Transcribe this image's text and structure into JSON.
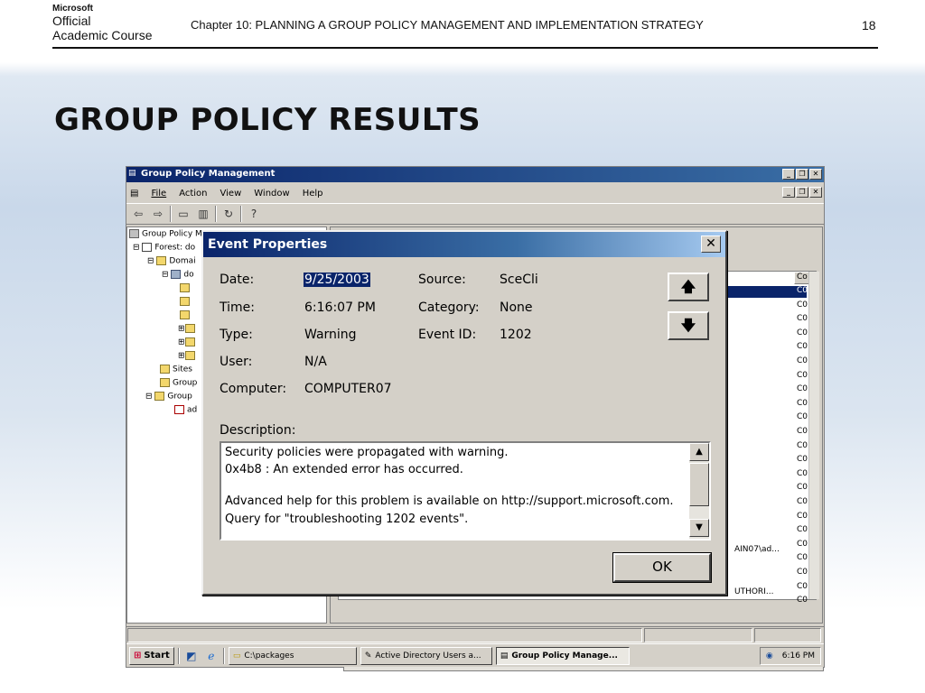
{
  "slide": {
    "logo": {
      "line0": "Microsoft",
      "line1": "Official",
      "line2": "Academic Course"
    },
    "chapter": "Chapter 10: PLANNING A GROUP POLICY MANAGEMENT AND IMPLEMENTATION STRATEGY",
    "page_number": "18",
    "title": "GROUP POLICY RESULTS"
  },
  "app": {
    "title": "Group Policy Management",
    "menu": [
      "File",
      "Action",
      "View",
      "Window",
      "Help"
    ],
    "tree": [
      "Group Policy M",
      "Forest: do",
      "Domai",
      "do",
      "Sites",
      "Group",
      "Group",
      "ad"
    ],
    "list_column_header": "Co",
    "list_code": "C0",
    "list_fragments": {
      "row1": "AIN07\\ad...",
      "row2": "UTHORI..."
    }
  },
  "dialog": {
    "title": "Event Properties",
    "fields": {
      "date_label": "Date:",
      "date_value": "9/25/2003",
      "time_label": "Time:",
      "time_value": "6:16:07 PM",
      "type_label": "Type:",
      "type_value": "Warning",
      "user_label": "User:",
      "user_value": "N/A",
      "computer_label": "Computer:",
      "computer_value": "COMPUTER07",
      "source_label": "Source:",
      "source_value": "SceCli",
      "category_label": "Category:",
      "category_value": "None",
      "eventid_label": "Event ID:",
      "eventid_value": "1202"
    },
    "description_label": "Description:",
    "description_lines": [
      "Security policies were propagated with warning.",
      "0x4b8 : An extended error has occurred.",
      "",
      "Advanced help for this problem is available on http://support.microsoft.com.",
      "Query for \"troubleshooting 1202 events\"."
    ],
    "up_icon": "arrow-up",
    "down_icon": "arrow-down",
    "ok_label": "OK"
  },
  "taskbar": {
    "start_label": "Start",
    "tasks": [
      "C:\\packages",
      "Active Directory Users a...",
      "Group Policy Manage..."
    ],
    "clock": "6:16 PM"
  }
}
